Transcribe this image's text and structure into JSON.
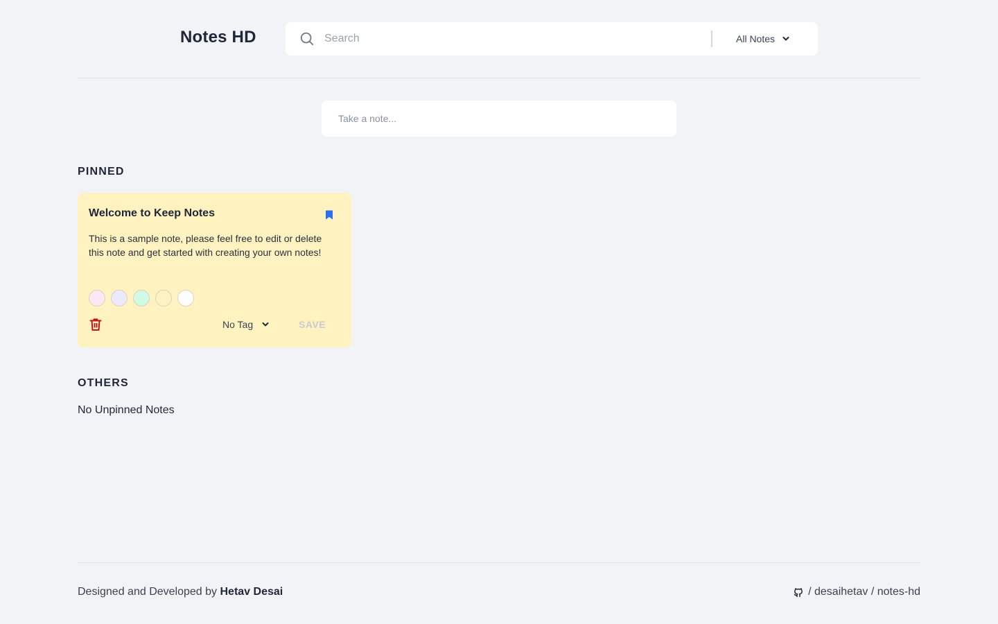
{
  "app": {
    "title": "Notes HD"
  },
  "search": {
    "placeholder": "Search",
    "value": ""
  },
  "filter": {
    "selected": "All Notes"
  },
  "composer": {
    "placeholder": "Take a note..."
  },
  "pinned": {
    "heading": "PINNED",
    "notes": [
      {
        "title": "Welcome to Keep Notes",
        "body": "This is a sample note, please feel free to edit or delete this note and get started with creating your own notes!",
        "color": "#fef3c0",
        "pinned": true,
        "swatch_colors": [
          "#fce7f3",
          "#ede9fe",
          "#d1fae5",
          "#fef3c0",
          "#ffffff"
        ],
        "tag": "No Tag",
        "save_label": "SAVE",
        "icons": {
          "pin": "bookmark-icon",
          "delete": "trash-icon",
          "tag_dropdown": "chevron-down-icon"
        }
      }
    ]
  },
  "others": {
    "heading": "OTHERS",
    "empty_text": "No Unpinned Notes"
  },
  "footer": {
    "credit_prefix": "Designed and Developed by",
    "author": "Hetav Desai",
    "repo": "/ desaihetav / notes-hd",
    "repo_icon": "github-icon"
  },
  "colors": {
    "accent_blue": "#2f6fed",
    "danger_red": "#c0151d",
    "background": "#f1f3f6"
  }
}
